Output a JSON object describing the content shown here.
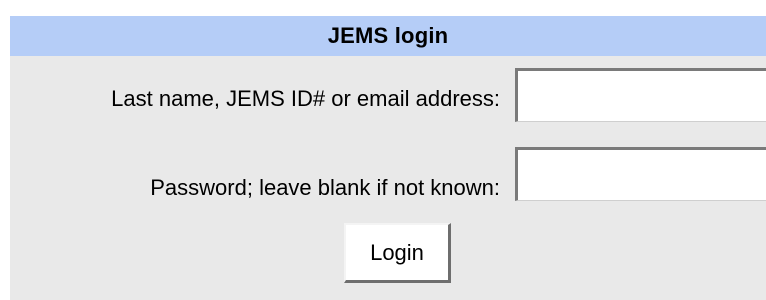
{
  "header": {
    "title": "JEMS login"
  },
  "form": {
    "username_label": "Last name, JEMS ID# or email address:",
    "username_value": "",
    "password_label": "Password; leave blank if not known:",
    "password_value": "",
    "login_button_label": "Login"
  },
  "colors": {
    "header_background": "#b5cdf7",
    "panel_background": "#e9e9e9"
  }
}
